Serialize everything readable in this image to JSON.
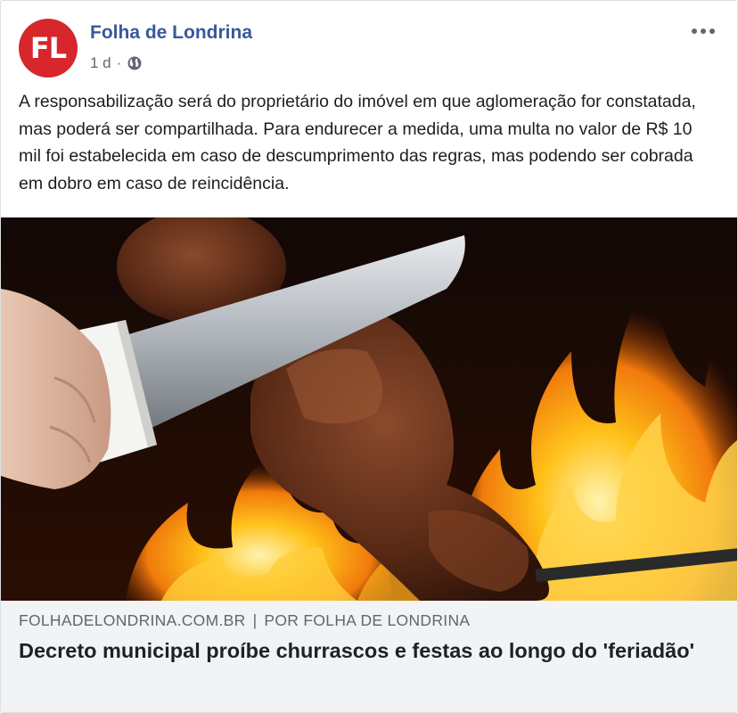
{
  "post": {
    "page_name": "Folha de Londrina",
    "avatar_text": "FL",
    "timestamp": "1 d",
    "separator": "·",
    "text": "A responsabilização será do proprietário do imóvel em que aglomeração for constatada, mas poderá ser compartilhada. Para endurecer a medida, uma multa no valor de R$ 10 mil foi estabelecida em caso de descumprimento das regras, mas podendo ser cobrada em dobro em caso de reincidência.",
    "privacy_icon": "globe-icon",
    "menu_icon": "more-icon"
  },
  "link": {
    "domain": "FOLHADELONDRINA.COM.BR",
    "divider": "|",
    "author": "POR FOLHA DE LONDRINA",
    "title": "Decreto municipal proíbe churrascos e festas ao longo do 'feriadão'",
    "image_subject": "knife slicing grilled meat skewer over fire"
  },
  "colors": {
    "brand_red": "#d7262c",
    "link_blue": "#385898",
    "secondary_text": "#606770",
    "link_panel_bg": "#f2f3f5"
  }
}
